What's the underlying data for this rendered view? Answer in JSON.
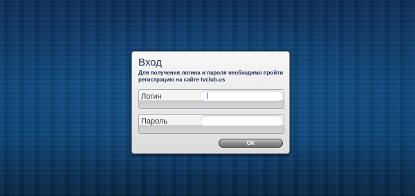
{
  "dialog": {
    "title": "Вход",
    "info": "Для получения логина и пароля необходимо пройти регистрацию на сайте tvclub.us",
    "login": {
      "label": "Логин",
      "value": ""
    },
    "password": {
      "label": "Пароль",
      "value": ""
    },
    "ok_label": "OK"
  },
  "colors": {
    "background": "#0a3868",
    "title_text": "#1f2f55",
    "dialog_bg": "#e8e8e8",
    "button_bg": "#8d8d8d"
  }
}
